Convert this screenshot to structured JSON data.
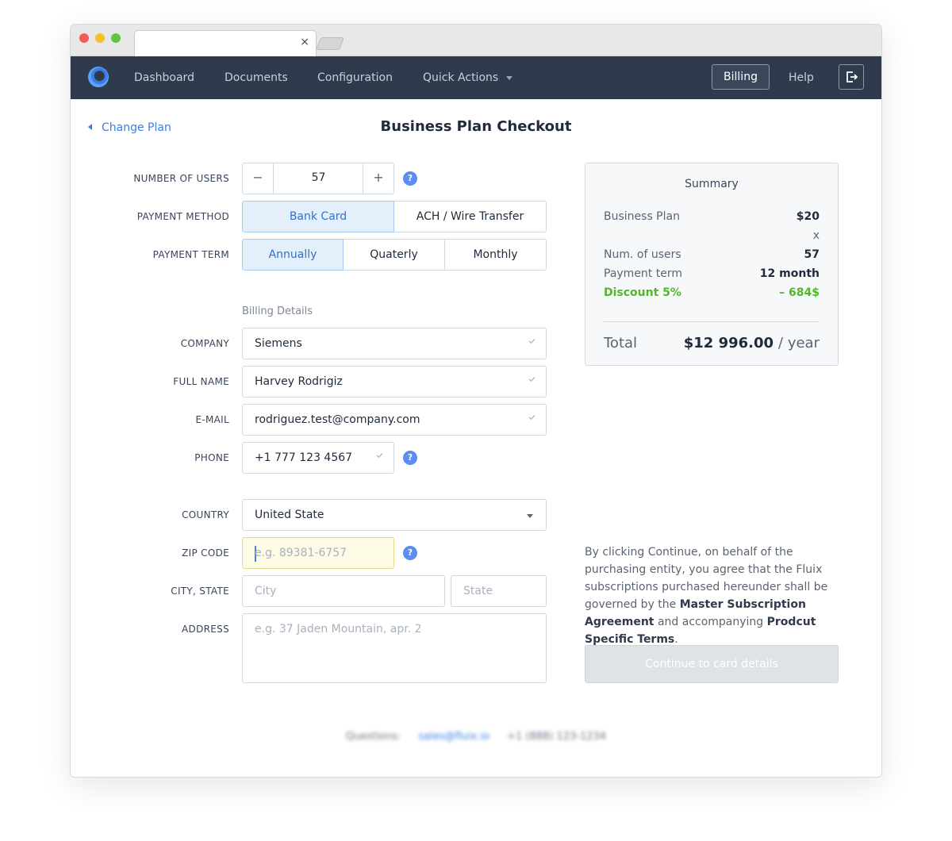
{
  "tab": {
    "close": "×"
  },
  "nav": {
    "items": [
      "Dashboard",
      "Documents",
      "Configuration",
      "Quick Actions"
    ],
    "billing": "Billing",
    "help": "Help"
  },
  "page": {
    "back": "Change Plan",
    "title": "Business Plan Checkout"
  },
  "form": {
    "users_label": "NUMBER OF USERS",
    "users_value": "57",
    "minus": "−",
    "plus": "+",
    "payment_method_label": "PAYMENT METHOD",
    "payment_methods": [
      "Bank Card",
      "ACH / Wire Transfer"
    ],
    "payment_term_label": "PAYMENT TERM",
    "payment_terms": [
      "Annually",
      "Quaterly",
      "Monthly"
    ],
    "billing_title": "Billing Details",
    "company_label": "COMPANY",
    "company_value": "Siemens",
    "name_label": "FULL NAME",
    "name_value": "Harvey Rodrigiz",
    "email_label": "E-MAIL",
    "email_value": "rodriguez.test@company.com",
    "phone_label": "PHONE",
    "phone_value": "+1 777 123 4567",
    "country_label": "COUNTRY",
    "country_value": "United State",
    "zip_label": "ZIP CODE",
    "zip_placeholder": "e.g. 89381-6757",
    "city_state_label": "CITY, STATE",
    "city_placeholder": "City",
    "state_placeholder": "State",
    "address_label": "ADDRESS",
    "address_placeholder": "e.g. 37 Jaden Mountain, apr. 2",
    "help": "?"
  },
  "summary": {
    "title": "Summary",
    "plan_label": "Business Plan",
    "plan_value": "$20",
    "times": "x",
    "users_label": "Num. of users",
    "users_value": "57",
    "term_label": "Payment term",
    "term_value": "12 month",
    "discount_label": "Discount 5%",
    "discount_value": "– 684$",
    "total_label": "Total",
    "total_value": "$12 996.00",
    "total_period": "/ year"
  },
  "terms": {
    "text1": "By clicking Continue, on behalf of the purchasing entity, you agree that the Fluix subscriptions purchased hereunder shall be governed by the ",
    "link1": "Master Subscription Agreement",
    "text2": " and accompanying ",
    "link2": "Prodcut Specific Terms",
    "text3": "."
  },
  "continue_button": "Continue to card details",
  "footer": {
    "questions": "Questions:",
    "email": "sales@fluix.io",
    "phone": "+1 (888) 123-1234"
  },
  "colors": {
    "nav_bg": "#2f3a4c",
    "accent": "#3d7de0",
    "discount": "#52b82a"
  }
}
